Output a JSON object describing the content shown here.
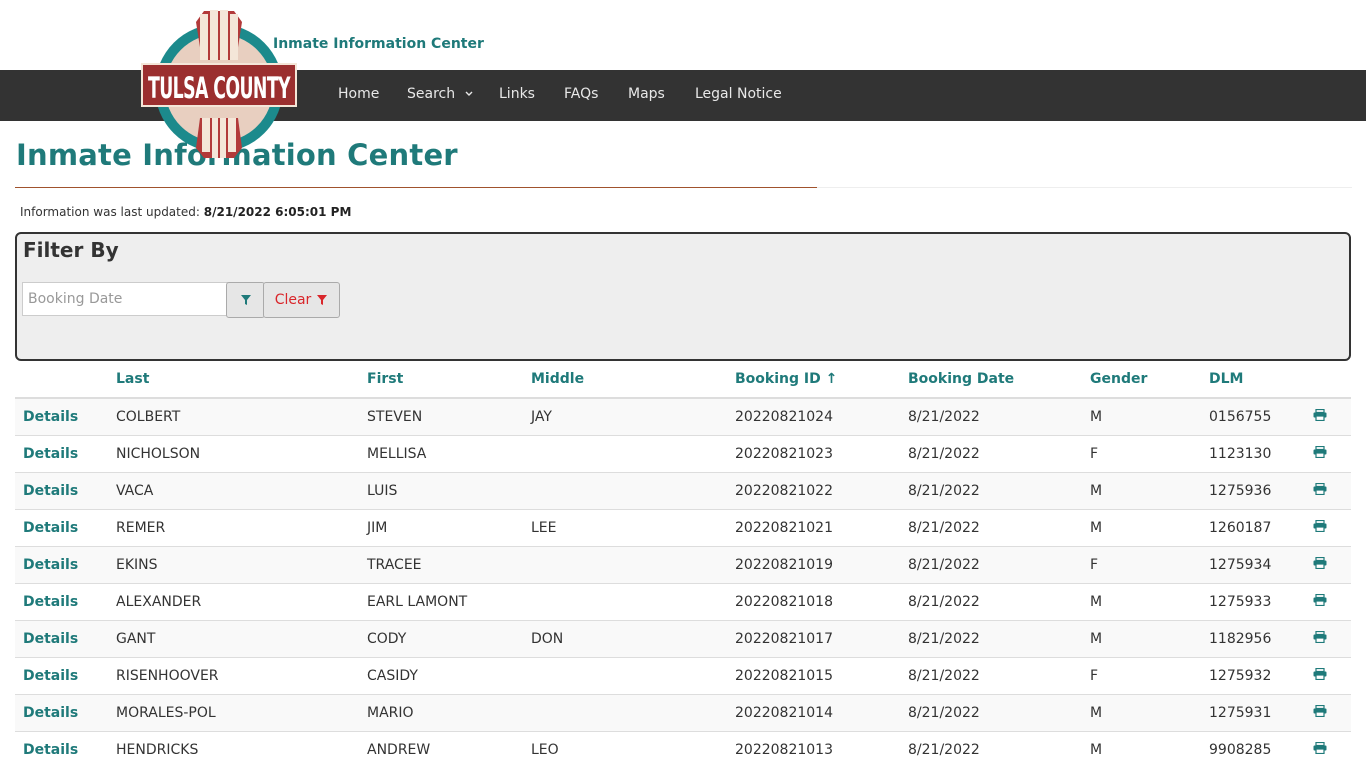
{
  "header": {
    "site_title": "Inmate Information Center",
    "logo_text": "TULSA COUNTY"
  },
  "nav": [
    {
      "label": "Home"
    },
    {
      "label": "Search"
    },
    {
      "label": "Links"
    },
    {
      "label": "FAQs"
    },
    {
      "label": "Maps"
    },
    {
      "label": "Legal Notice"
    }
  ],
  "page": {
    "title": "Inmate Information Center",
    "updated_label": "Information was last updated:",
    "updated_value": "8/21/2022 6:05:01 PM"
  },
  "filter": {
    "title": "Filter By",
    "booking_date_placeholder": "Booking Date",
    "clear_label": "Clear"
  },
  "table": {
    "columns": [
      "",
      "Last",
      "First",
      "Middle",
      "Booking ID ↑",
      "Booking Date",
      "Gender",
      "DLM",
      ""
    ],
    "details_label": "Details",
    "rows": [
      {
        "last": "COLBERT",
        "first": "STEVEN",
        "middle": "JAY",
        "booking_id": "20220821024",
        "booking_date": "8/21/2022",
        "gender": "M",
        "dlm": "0156755"
      },
      {
        "last": "NICHOLSON",
        "first": "MELLISA",
        "middle": "",
        "booking_id": "20220821023",
        "booking_date": "8/21/2022",
        "gender": "F",
        "dlm": "1123130"
      },
      {
        "last": "VACA",
        "first": "LUIS",
        "middle": "",
        "booking_id": "20220821022",
        "booking_date": "8/21/2022",
        "gender": "M",
        "dlm": "1275936"
      },
      {
        "last": "REMER",
        "first": "JIM",
        "middle": "LEE",
        "booking_id": "20220821021",
        "booking_date": "8/21/2022",
        "gender": "M",
        "dlm": "1260187"
      },
      {
        "last": "EKINS",
        "first": "TRACEE",
        "middle": "",
        "booking_id": "20220821019",
        "booking_date": "8/21/2022",
        "gender": "F",
        "dlm": "1275934"
      },
      {
        "last": "ALEXANDER",
        "first": "EARL LAMONT",
        "middle": "",
        "booking_id": "20220821018",
        "booking_date": "8/21/2022",
        "gender": "M",
        "dlm": "1275933"
      },
      {
        "last": "GANT",
        "first": "CODY",
        "middle": "DON",
        "booking_id": "20220821017",
        "booking_date": "8/21/2022",
        "gender": "M",
        "dlm": "1182956"
      },
      {
        "last": "RISENHOOVER",
        "first": "CASIDY",
        "middle": "",
        "booking_id": "20220821015",
        "booking_date": "8/21/2022",
        "gender": "F",
        "dlm": "1275932"
      },
      {
        "last": "MORALES-POL",
        "first": "MARIO",
        "middle": "",
        "booking_id": "20220821014",
        "booking_date": "8/21/2022",
        "gender": "M",
        "dlm": "1275931"
      },
      {
        "last": "HENDRICKS",
        "first": "ANDREW",
        "middle": "LEO",
        "booking_id": "20220821013",
        "booking_date": "8/21/2022",
        "gender": "M",
        "dlm": "9908285"
      }
    ]
  },
  "colors": {
    "accent": "#1f7a7a",
    "navbar": "#333333",
    "clear_red": "#d9262b",
    "rule": "#a0522d"
  }
}
